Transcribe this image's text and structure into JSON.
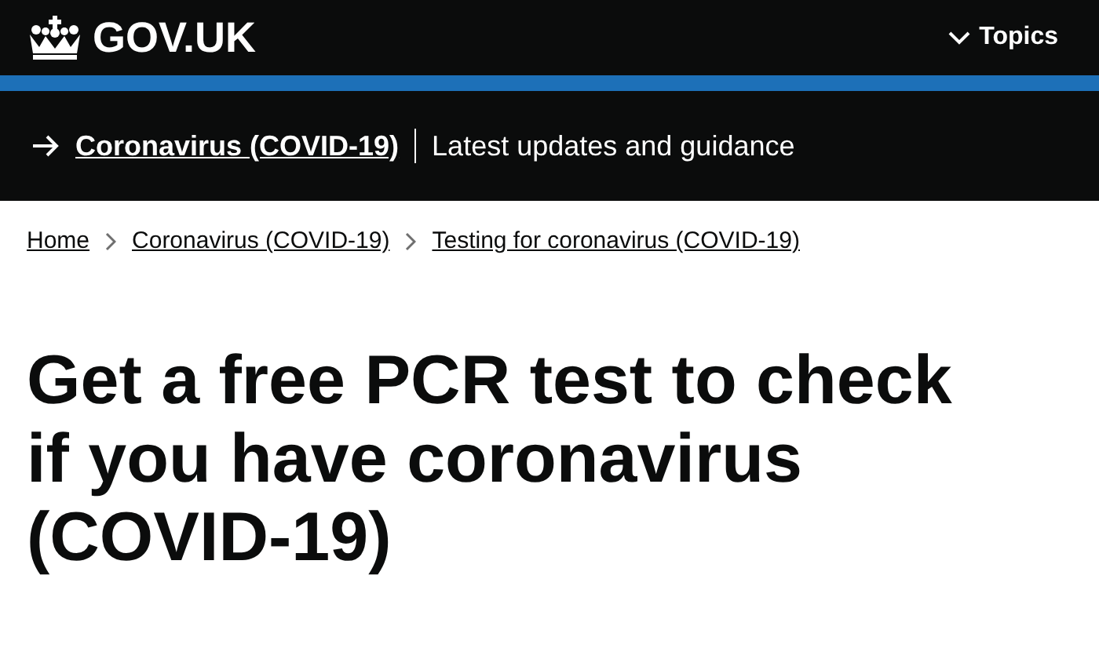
{
  "header": {
    "logo": "GOV.UK",
    "menu": "Topics"
  },
  "banner": {
    "link": "Coronavirus (COVID-19)",
    "text": "Latest updates and guidance"
  },
  "breadcrumbs": [
    {
      "label": "Home"
    },
    {
      "label": "Coronavirus (COVID-19)"
    },
    {
      "label": "Testing for coronavirus (COVID-19)"
    }
  ],
  "title": "Get a free PCR test to check if you have coronavirus (COVID-19)"
}
